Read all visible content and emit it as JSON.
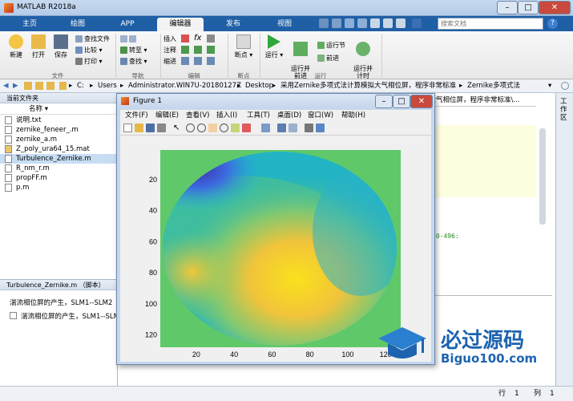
{
  "app": {
    "title": "MATLAB R2018a",
    "min": "–",
    "max": "□",
    "close": "✕"
  },
  "tabs": [
    {
      "label": "主页"
    },
    {
      "label": "绘图"
    },
    {
      "label": "APP"
    },
    {
      "label": "编辑器"
    },
    {
      "label": "发布"
    },
    {
      "label": "视图"
    }
  ],
  "search": {
    "placeholder": "搜索文档"
  },
  "ribbon": {
    "new": "新建",
    "open": "打开",
    "save": "保存",
    "find_file": "查找文件",
    "compare": "比较",
    "print": "打印",
    "goto": "转至",
    "find": "查找",
    "insert": "插入",
    "comment": "注释",
    "indent": "缩进",
    "breakpoint": "断点",
    "run": "运行",
    "run_advance": "运行并\n前进",
    "run_section": "运行节",
    "advance": "前进",
    "run_time": "运行并\n计时",
    "groups": {
      "file": "文件",
      "nav": "导航",
      "edit": "编辑",
      "bp": "断点",
      "run": "运行"
    }
  },
  "path": {
    "segments": [
      "C:",
      "Users",
      "Administrator.WIN7U-20180127Z",
      "Desktop",
      "采用Zernike多项式法计算模拟大气相位屏，程序非常标准",
      "Zernike多项式法"
    ]
  },
  "folder_panel": {
    "title": "当前文件夹",
    "column": "名称",
    "files": [
      {
        "name": "说明.txt"
      },
      {
        "name": "zernike_feneer_.m"
      },
      {
        "name": "zernike_a.m"
      },
      {
        "name": "Z_poly_ura64_15.mat"
      },
      {
        "name": "Turbulence_Zernike.m"
      },
      {
        "name": "R_nm_r.m"
      },
      {
        "name": "propFF.m"
      },
      {
        "name": "p.m"
      }
    ]
  },
  "details": {
    "title": "Turbulence_Zernike.m （脚本）",
    "line1": "湍流相位屏的产生，SLM1--SLM2",
    "line2": "湍流相位屏的产生，SLM1--SLM"
  },
  "editor": {
    "tab_path": "拟大气相位屏，程序非常标准\\...",
    "code_fragment": "30-496:"
  },
  "right_panel": {
    "label": "工作区"
  },
  "status": {
    "row_label": "行",
    "row": "1",
    "col_label": "列",
    "col": "1"
  },
  "figure": {
    "title": "Figure 1",
    "menu": [
      "文件(F)",
      "编辑(E)",
      "查看(V)",
      "插入(I)",
      "工具(T)",
      "桌面(D)",
      "窗口(W)",
      "帮助(H)"
    ],
    "bg_color": "#5fc96a"
  },
  "chart_data": {
    "type": "heatmap",
    "title": "",
    "xlabel": "",
    "ylabel": "",
    "xlim": [
      1,
      128
    ],
    "ylim": [
      1,
      128
    ],
    "y_reversed": true,
    "xticks": [
      20,
      40,
      60,
      80,
      100,
      120
    ],
    "yticks": [
      20,
      40,
      60,
      80,
      100,
      120
    ],
    "colormap": "parula",
    "mask": "circular aperture, values shown only inside disk; outside is mid-level green",
    "features": [
      {
        "description": "low (blue) region",
        "x": 30,
        "y": 18
      },
      {
        "description": "high (yellow) region",
        "x": 70,
        "y": 82
      },
      {
        "description": "medium-high (yellow-orange) lobe",
        "x": 30,
        "y": 90
      }
    ]
  },
  "watermark": {
    "text1": "必过源码",
    "text2": "Biguo100.com"
  }
}
